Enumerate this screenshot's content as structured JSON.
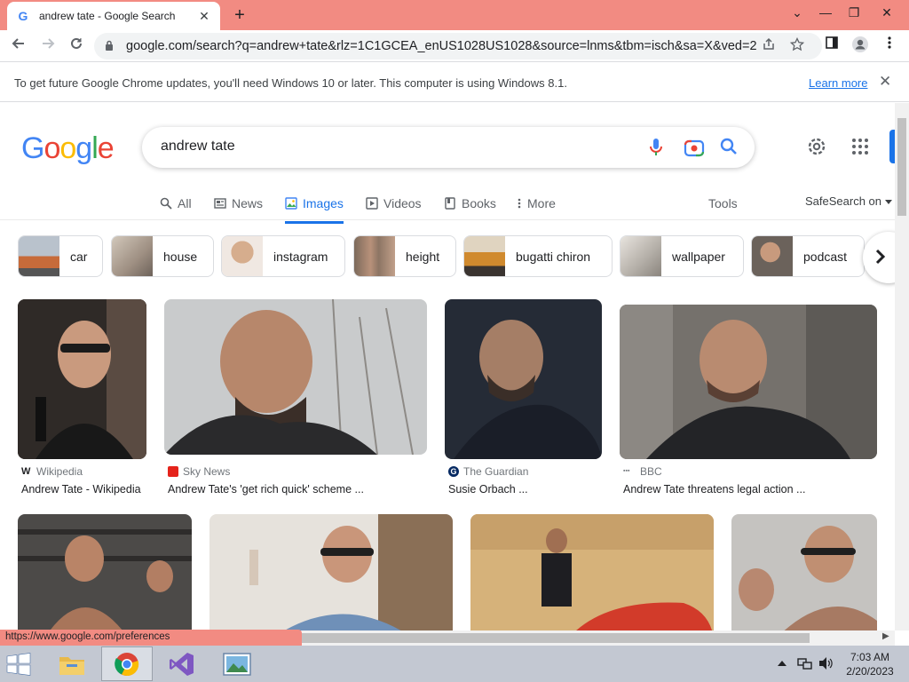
{
  "browser": {
    "tab_title": "andrew tate - Google Search",
    "tab_favicon": "G",
    "new_tab": "+",
    "url": "google.com/search?q=andrew+tate&rlz=1C1GCEA_enUS1028US1028&source=lnms&tbm=isch&sa=X&ved=2a...",
    "window_controls": {
      "minimize": "—",
      "restore": "❐",
      "close": "✕",
      "tabstrip": "⌄"
    }
  },
  "infobar": {
    "text": "To get future Google Chrome updates, you'll need Windows 10 or later. This computer is using Windows 8.1.",
    "link": "Learn more",
    "close": "✕"
  },
  "search": {
    "logo": [
      "G",
      "o",
      "o",
      "g",
      "l",
      "e"
    ],
    "query": "andrew tate"
  },
  "nav": {
    "tabs": [
      {
        "label": "All",
        "icon": "search-icon"
      },
      {
        "label": "News",
        "icon": "news-icon"
      },
      {
        "label": "Images",
        "icon": "image-icon",
        "active": true
      },
      {
        "label": "Videos",
        "icon": "play-icon"
      },
      {
        "label": "Books",
        "icon": "book-icon"
      },
      {
        "label": "More",
        "icon": "more-vert-icon"
      }
    ],
    "tools": "Tools",
    "safesearch": "SafeSearch on"
  },
  "chips": [
    {
      "label": "car",
      "thumb_color": "#c76b3a"
    },
    {
      "label": "house",
      "thumb_color": "#9e8f82"
    },
    {
      "label": "instagram",
      "thumb_color": "#c9a284"
    },
    {
      "label": "height",
      "thumb_color": "#8d7564"
    },
    {
      "label": "bugatti chiron",
      "thumb_color": "#d08a2e"
    },
    {
      "label": "wallpaper",
      "thumb_color": "#b7b2ab"
    },
    {
      "label": "podcast",
      "thumb_color": "#6b625b"
    }
  ],
  "results": [
    {
      "source": "Wikipedia",
      "source_icon": "W",
      "title": "Andrew Tate - Wikipedia",
      "bg": "#3b3530",
      "skin": "#c99a7e"
    },
    {
      "source": "Sky News",
      "source_icon": "sky",
      "title": "Andrew Tate's 'get rich quick' scheme ...",
      "bg": "#b9bcbf",
      "skin": "#b7876b"
    },
    {
      "source": "The Guardian",
      "source_icon": "G",
      "title": "Susie Orbach ...",
      "bg": "#2d3440",
      "skin": "#a57e66"
    },
    {
      "source": "BBC",
      "source_icon": "BBC",
      "title": "Andrew Tate threatens legal action ...",
      "bg": "#6d6a67",
      "skin": "#b98b70"
    }
  ],
  "row2": [
    {
      "bg": "#4c4a48",
      "skin": "#b98467"
    },
    {
      "bg": "#8a6f56",
      "skin": "#c9967a"
    },
    {
      "bg": "#c79a62",
      "skin": "#a06f52"
    },
    {
      "bg": "#c5c3c0",
      "skin": "#c08f72"
    }
  ],
  "status": {
    "url": "https://www.google.com/preferences"
  },
  "taskbar": {
    "time": "7:03 AM",
    "date": "2/20/2023"
  },
  "colors": {
    "chrome_frame": "#f28b82",
    "google_blue": "#4285f4",
    "google_red": "#ea4335",
    "google_yellow": "#fbbc05",
    "google_green": "#34a853",
    "link": "#1a73e8"
  }
}
